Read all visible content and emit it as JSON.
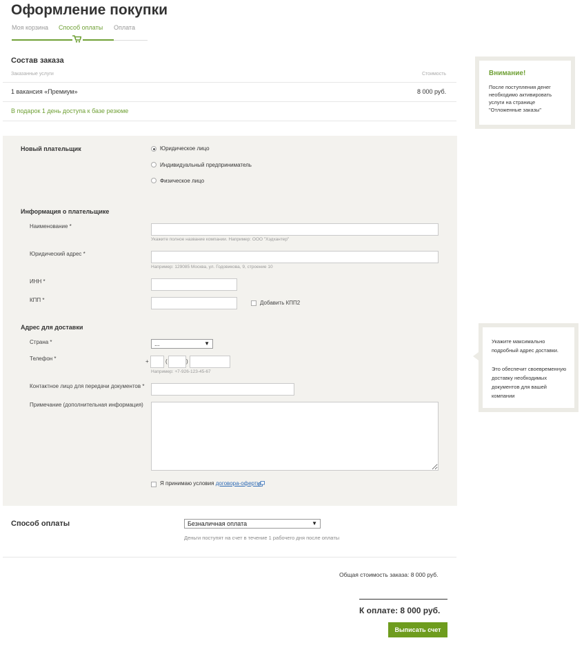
{
  "page": {
    "title": "Оформление покупки"
  },
  "steps": [
    {
      "label": "Моя корзина"
    },
    {
      "label": "Способ оплаты"
    },
    {
      "label": "Оплата"
    }
  ],
  "order": {
    "title": "Состав заказа",
    "col_services": "Заказанные услуги",
    "col_price": "Стоимость",
    "item_name": "1 вакансия «Премиум»",
    "item_price": "8 000 руб.",
    "gift": "В подарок 1 день доступа к базе резюме"
  },
  "notice": {
    "title": "Внимание!",
    "text": "После поступления денег необходимо активировать услуги на странице \"Отложенные заказы\""
  },
  "payer": {
    "title": "Новый плательщик",
    "options": [
      "Юридическое лицо",
      "Индивидуальный предприниматель",
      "Физическое лицо"
    ],
    "selected": 0
  },
  "payer_info": {
    "title": "Информация о плательщике",
    "name_label": "Наименование *",
    "name_value": "",
    "name_hint": "Укажите полное название компании. Например: ООО \"Хэдхантер\"",
    "address_label": "Юридический адрес *",
    "address_value": "",
    "address_hint": "Например: 129085 Москва, ул. Годовикова, 9, строение 10",
    "inn_label": "ИНН *",
    "inn_value": "",
    "kpp_label": "КПП *",
    "kpp_value": "",
    "add_kpp2": "Добавить КПП2"
  },
  "delivery": {
    "title": "Адрес для доставки",
    "country_label": "Страна *",
    "country_value": "...",
    "phone_label": "Телефон *",
    "phone_plus": "+",
    "phone_open": "(",
    "phone_close": ")",
    "phone_hint": "Например: +7-926-123-45-67",
    "contact_label": "Контактное лицо для передачи документов *",
    "contact_value": "",
    "note_label": "Примечание (дополнительная информация)",
    "note_value": "",
    "terms_prefix": "Я принимаю условия",
    "terms_link": "договора-оферты"
  },
  "delivery_tip": {
    "p1": "Укажите максимально подробный адрес доставки.",
    "p2": "Это обеспечит своевременную доставку необходимых документов для вашей компании"
  },
  "payment": {
    "title": "Способ оплаты",
    "selected": "Безналичная оплата",
    "hint": "Деньги поступят на счет в течение 1 рабочего дня после оплаты"
  },
  "totals": {
    "total_text": "Общая стоимость заказа: 8 000 руб.",
    "to_pay": "К оплате: 8 000 руб.",
    "button": "Выписать счет"
  },
  "colors": {
    "accent": "#6fa035",
    "button": "#6e9c1e",
    "form_bg": "#f3f2ee",
    "link": "#2f6bb5"
  }
}
